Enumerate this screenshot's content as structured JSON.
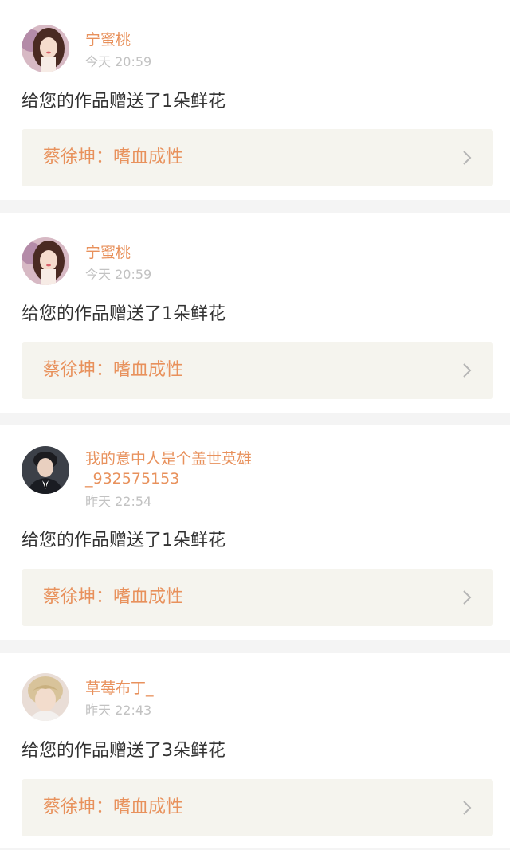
{
  "colors": {
    "accent": "#e8915c",
    "timestamp": "#c2c2c2",
    "message_text": "#333333",
    "work_link_bg": "#f5f4ee",
    "separator": "#f4f4f4"
  },
  "notifications": [
    {
      "user_name_lines": [
        "宁蜜桃"
      ],
      "timestamp": "今天 20:59",
      "message": "给您的作品赠送了1朵鲜花",
      "work_title": "蔡徐坤：嗜血成性",
      "avatar": "user-avatar-woman",
      "arrow_icon": "chevron-right-icon"
    },
    {
      "user_name_lines": [
        "宁蜜桃"
      ],
      "timestamp": "今天 20:59",
      "message": "给您的作品赠送了1朵鲜花",
      "work_title": "蔡徐坤：嗜血成性",
      "avatar": "user-avatar-woman",
      "arrow_icon": "chevron-right-icon"
    },
    {
      "user_name_lines": [
        "我的意中人是个盖世英雄",
        "_932575153"
      ],
      "timestamp": "昨天 22:54",
      "message": "给您的作品赠送了1朵鲜花",
      "work_title": "蔡徐坤：嗜血成性",
      "avatar": "user-avatar-man-suit",
      "arrow_icon": "chevron-right-icon"
    },
    {
      "user_name_lines": [
        "草莓布丁_"
      ],
      "timestamp": "昨天 22:43",
      "message": "给您的作品赠送了3朵鲜花",
      "work_title": "蔡徐坤：嗜血成性",
      "avatar": "user-avatar-blond",
      "arrow_icon": "chevron-right-icon"
    }
  ]
}
